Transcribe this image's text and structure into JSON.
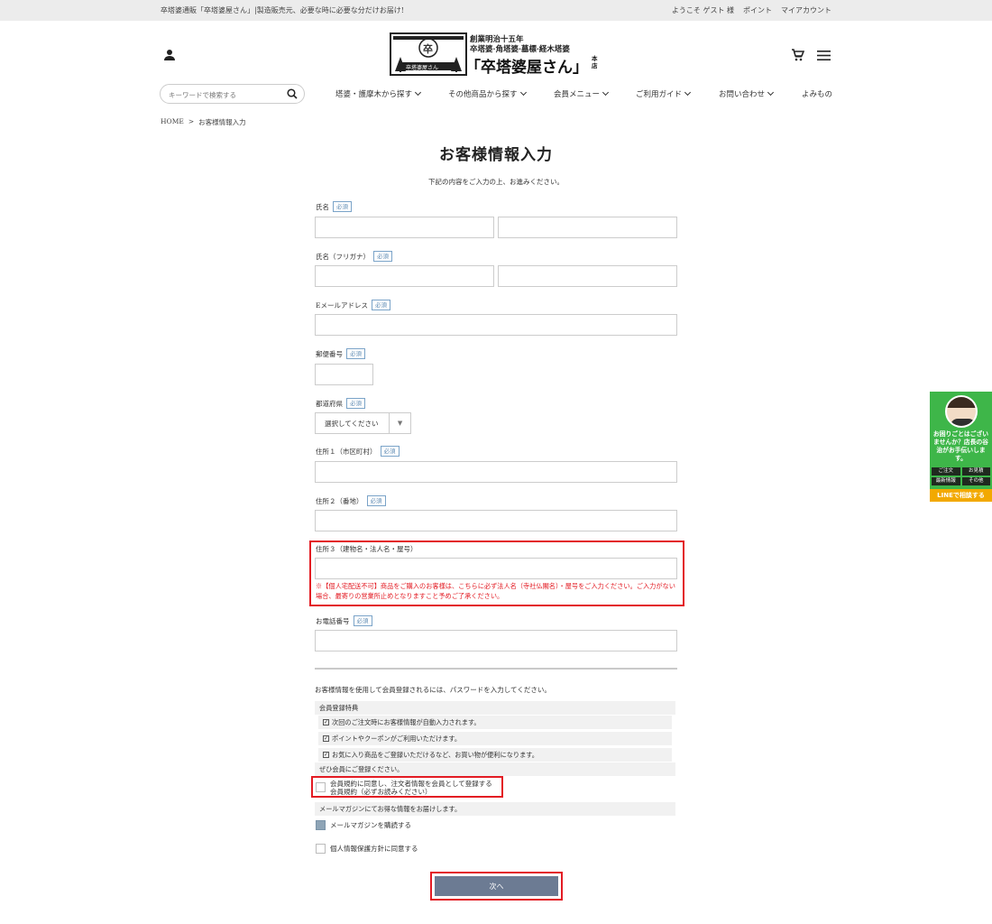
{
  "topbar": {
    "tagline": "卒塔婆通販「卒塔婆屋さん」|製造販売元、必要な時に必要な分だけお届け!",
    "welcome": "ようこそ ゲスト 様",
    "points": "ポイント",
    "my_account": "マイアカウント"
  },
  "logo": {
    "line1": "創業明治十五年",
    "line2": "卒塔婆·角塔婆·墓標·経木塔婆",
    "name": "「卒塔婆屋さん」",
    "suffix": "本店",
    "badge": "卒",
    "badge_label": "卒塔婆屋さん"
  },
  "search": {
    "placeholder": "キーワードで検索する"
  },
  "nav": {
    "items": [
      {
        "label": "塔婆・護摩木から探す"
      },
      {
        "label": "その他商品から探す"
      },
      {
        "label": "会員メニュー"
      },
      {
        "label": "ご利用ガイド"
      },
      {
        "label": "お問い合わせ"
      },
      {
        "label": "よみもの"
      }
    ]
  },
  "breadcrumb": {
    "home": "HOME",
    "sep": ">",
    "current": "お客様情報入力"
  },
  "page": {
    "title": "お客様情報入力",
    "intro": "下記の内容をご入力の上、お進みください。"
  },
  "form": {
    "required": "必須",
    "name_label": "氏名",
    "kana_label": "氏名（フリガナ）",
    "email_label": "Eメールアドレス",
    "zip_label": "郵便番号",
    "pref_label": "都道府県",
    "pref_value": "選択してください",
    "addr1_label": "住所１（市区町村）",
    "addr2_label": "住所２（番地）",
    "addr3_label": "住所３（建物名・法人名・屋号）",
    "addr3_note": "※【個人宅配送不可】商品をご購入のお客様は、こちらに必ず法人名（寺社仏閣名）・屋号をご入力ください。ご入力がない場合、最寄りの営業所止めとなりますこと予めご了承ください。",
    "phone_label": "お電話番号"
  },
  "member": {
    "intro": "お客様情報を使用して会員登録されるには、パスワードを入力してください。",
    "benefits_title": "会員登録特典",
    "benefits": [
      "次回のご注文時にお客様情報が自動入力されます。",
      "ポイントやクーポンがご利用いただけます。",
      "お気に入り商品をご登録いただけるなど、お買い物が便利になります。"
    ],
    "recommend": "ぜひ会員にご登録ください。",
    "agree_line1": "会員規約に同意し、注文者情報を会員として登録する",
    "agree_line2": "会員規約（必ずお読みください）",
    "newsletter_info": "メールマガジンにてお得な情報をお届けします。",
    "newsletter_label": "メールマガジンを購読する",
    "privacy_label": "個人情報保護方針に同意する"
  },
  "next_button": "次へ",
  "line_banner": {
    "message": "お困りごとはございませんか？店長の谷治がお手伝いします。",
    "tags": [
      "ご注文",
      "お見積",
      "最新情報",
      "その他"
    ],
    "cta": "LINEで相談する"
  },
  "colors": {
    "accent_red": "#e31b23",
    "button": "#6c7b93",
    "line_green": "#3eb649"
  }
}
